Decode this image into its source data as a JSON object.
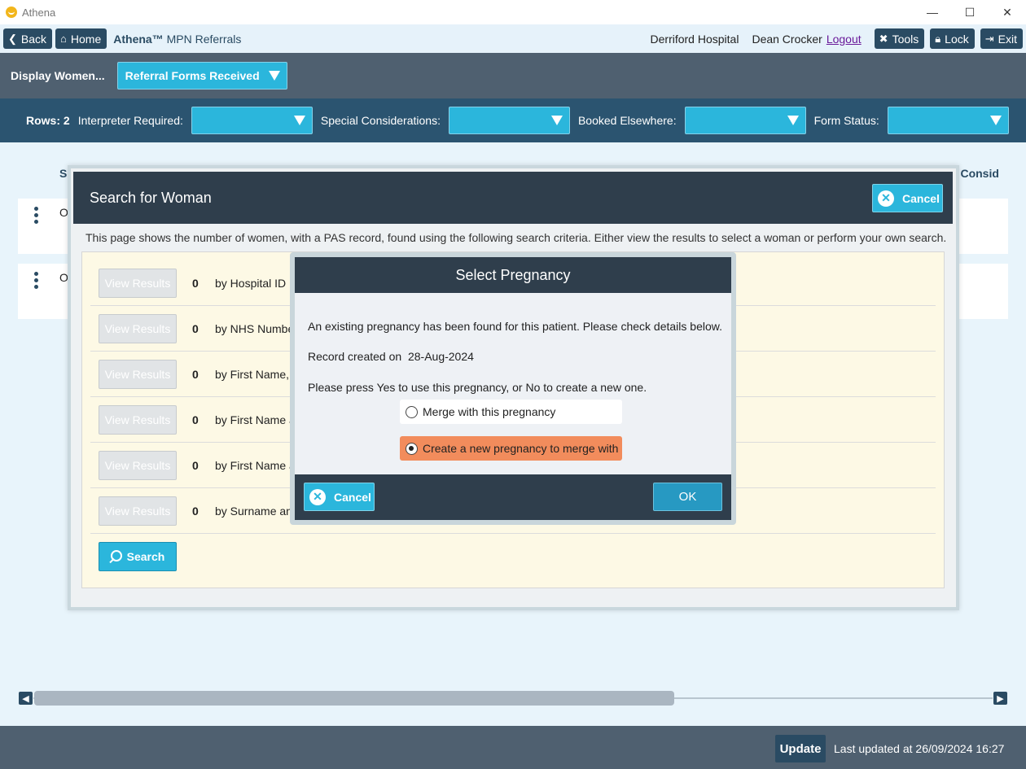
{
  "window": {
    "title": "Athena",
    "controls": {
      "minimize": "—",
      "maximize": "☐",
      "close": "✕"
    }
  },
  "nav": {
    "back_label": "Back",
    "home_label": "Home",
    "brand_name": "Athena™",
    "brand_sub": "MPN Referrals",
    "hospital": "Derriford Hospital",
    "user": "Dean Crocker",
    "logout_label": "Logout",
    "tools_label": "Tools",
    "lock_label": "Lock",
    "exit_label": "Exit"
  },
  "display_bar": {
    "label": "Display Women...",
    "selected": "Referral Forms Received"
  },
  "filters": {
    "rows_label": "Rows: 2",
    "interpreter_label": "Interpreter Required:",
    "special_label": "Special Considerations:",
    "booked_label": "Booked Elsewhere:",
    "form_status_label": "Form Status:"
  },
  "background_list": {
    "col_first": "Sc",
    "col_last": "ial Consid",
    "rows": [
      {
        "text": "Or"
      },
      {
        "text": "Or"
      }
    ]
  },
  "search_dialog": {
    "title": "Search for Woman",
    "cancel_label": "Cancel",
    "info": "This page shows the number of women, with a PAS record, found using the following search criteria. Either view the results to select a woman or perform your own search.",
    "view_results_label": "View Results",
    "criteria": [
      {
        "count": "0",
        "label": "by Hospital ID"
      },
      {
        "count": "0",
        "label": "by NHS Number"
      },
      {
        "count": "0",
        "label": "by First Name, S"
      },
      {
        "count": "0",
        "label": "by First Name a"
      },
      {
        "count": "0",
        "label": "by First Name a"
      },
      {
        "count": "0",
        "label": "by Surname and"
      }
    ],
    "search_label": "Search"
  },
  "pregnancy_modal": {
    "title": "Select Pregnancy",
    "message": "An existing pregnancy has been found for this patient. Please check details below.",
    "record_created_label": "Record created on",
    "record_created_date": "28-Aug-2024",
    "instruction": "Please press Yes to use this pregnancy, or No to create a new one.",
    "option_merge": "Merge with this pregnancy",
    "option_create": "Create a new pregnancy to merge with",
    "selected_option": "create",
    "cancel_label": "Cancel",
    "ok_label": "OK"
  },
  "footer": {
    "update_label": "Update",
    "last_updated": "Last updated at 26/09/2024 16:27"
  },
  "colors": {
    "accent": "#2bb6dc",
    "dark": "#2f3e4c",
    "navy": "#2a4b63",
    "selected_option": "#f28c5c"
  }
}
